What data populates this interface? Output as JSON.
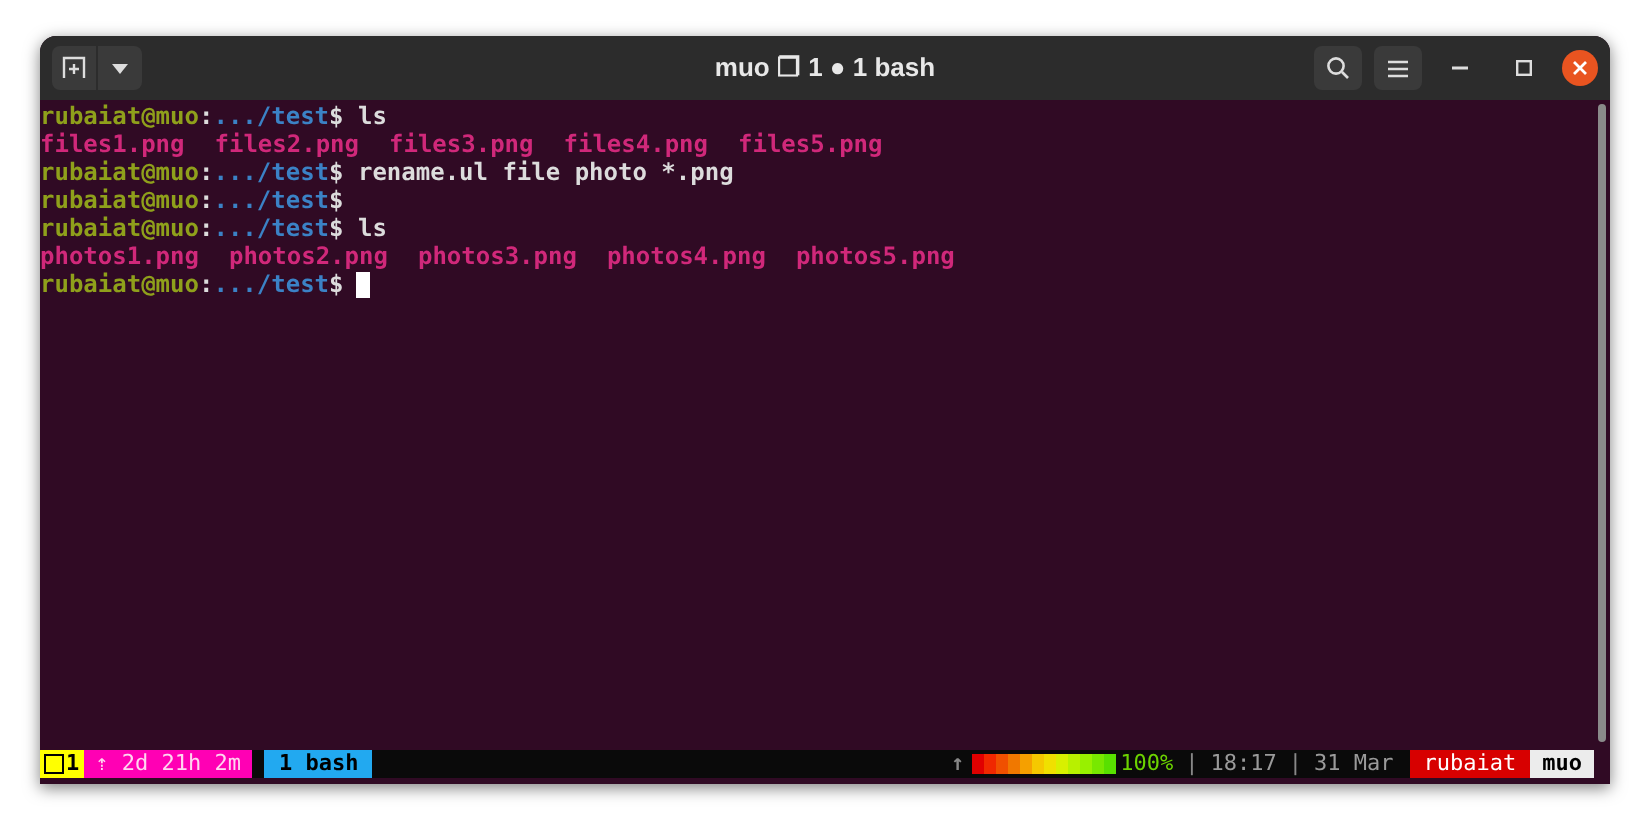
{
  "window": {
    "title": "muo ❐ 1 ● 1 bash"
  },
  "terminal": {
    "lines": [
      {
        "kind": "prompt",
        "user": "rubaiat@muo",
        "separator": ":",
        "path": ".../test",
        "command": "$ ls"
      },
      {
        "kind": "output",
        "files": [
          "files1.png",
          "files2.png",
          "files3.png",
          "files4.png",
          "files5.png"
        ]
      },
      {
        "kind": "prompt",
        "user": "rubaiat@muo",
        "separator": ":",
        "path": ".../test",
        "command": "$ rename.ul file photo *.png"
      },
      {
        "kind": "prompt",
        "user": "rubaiat@muo",
        "separator": ":",
        "path": ".../test",
        "command": "$"
      },
      {
        "kind": "prompt",
        "user": "rubaiat@muo",
        "separator": ":",
        "path": ".../test",
        "command": "$ ls"
      },
      {
        "kind": "output",
        "files": [
          "photos1.png",
          "photos2.png",
          "photos3.png",
          "photos4.png",
          "photos5.png"
        ]
      },
      {
        "kind": "prompt",
        "user": "rubaiat@muo",
        "separator": ":",
        "path": ".../test",
        "command": "$",
        "cursor": true
      }
    ]
  },
  "status_bar": {
    "session": "1",
    "uptime": "⇡ 2d 21h 2m",
    "windows": [
      {
        "label": "1 bash",
        "selected": true
      }
    ],
    "upload": "↑",
    "battery": {
      "level": 1.0
    },
    "battery_text": "100%",
    "divider_1": "|",
    "time": "18:17",
    "divider_2": "|",
    "date": "31 Mar",
    "user": "rubaiat",
    "host": "muo"
  }
}
